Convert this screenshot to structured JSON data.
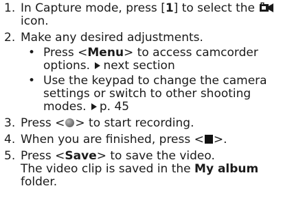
{
  "steps": [
    {
      "num": "1.",
      "l1_a": "In Capture mode, press [",
      "l1_key": "1",
      "l1_b": "] to select the",
      "l2": "icon."
    },
    {
      "num": "2.",
      "l1": "Make any desired adjustments.",
      "subs": [
        {
          "bullet": "•",
          "l1_a": "Press <",
          "l1_key": "Menu",
          "l1_b": "> to access camcorder",
          "l2_a": "options.",
          "l2_b": "next section"
        },
        {
          "bullet": "•",
          "l1": "Use the keypad to change the camera",
          "l2": "settings or switch to other shooting",
          "l3_a": "modes.",
          "l3_b": "p. 45"
        }
      ]
    },
    {
      "num": "3.",
      "l1_a": "Press <",
      "l1_b": "> to start recording."
    },
    {
      "num": "4.",
      "l1_a": "When you are finished, press <",
      "l1_b": ">."
    },
    {
      "num": "5.",
      "l1_a": "Press <",
      "l1_key": "Save",
      "l1_b": "> to save the video.",
      "l2_a": "The video clip is saved in the",
      "l2_key": "My album",
      "l3": "folder."
    }
  ],
  "icons": {
    "camcorder": "camcorder-icon",
    "record": "record-key-icon",
    "stop": "stop-key-icon",
    "arrow": "arrow-right-icon"
  }
}
